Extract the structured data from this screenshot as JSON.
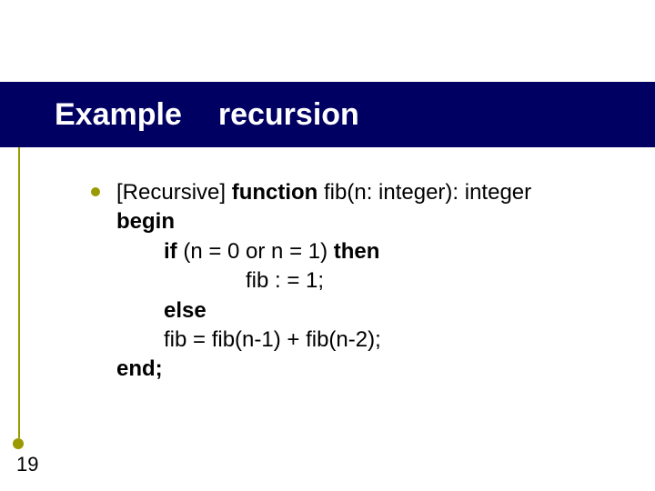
{
  "title": {
    "word1": "Example",
    "word2": "recursion"
  },
  "page_number": "19",
  "code": {
    "recursive_tag": "[Recursive] ",
    "kw_function": "function",
    "sig_rest": " fib(n: integer): integer",
    "kw_begin": "begin",
    "kw_if": "if",
    "cond": " (n = 0 or n = 1)  ",
    "kw_then": "then",
    "assign": "fib : = 1;",
    "kw_else": "else",
    "rec_line": "fib = fib(n-1) + fib(n-2);",
    "kw_end": "end;"
  }
}
